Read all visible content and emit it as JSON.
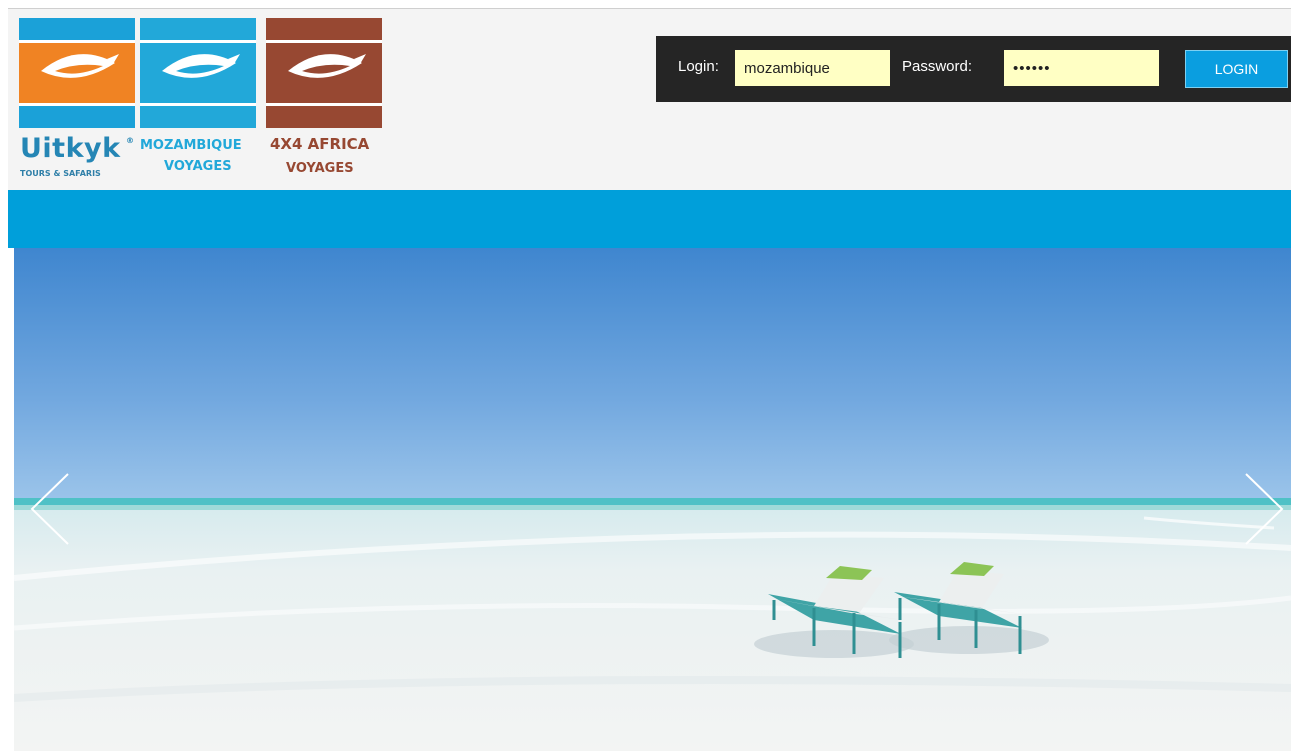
{
  "brands": {
    "uitkyk": {
      "name": "Uitkyk",
      "registered": "®",
      "subtitle": "TOURS & SAFARIS",
      "icon": "eye-logo-icon",
      "color": "#f08323"
    },
    "mozambique": {
      "line1": "MOZAMBIQUE",
      "line2": "VOYAGES",
      "icon": "eye-logo-icon",
      "color": "#22a8d9"
    },
    "africa": {
      "line1": "4X4 AFRICA",
      "line2": "VOYAGES",
      "icon": "eye-logo-icon",
      "color": "#974832"
    }
  },
  "login_form": {
    "login_label": "Login:",
    "login_value": "mozambique",
    "password_label": "Password:",
    "password_value": "••••••",
    "button_label": "LOGIN"
  },
  "carousel": {
    "prev_icon": "chevron-left-icon",
    "next_icon": "chevron-right-icon",
    "slide": "beach-loungers-slide"
  },
  "colors": {
    "nav_strip": "#009fda",
    "login_bar": "#252525",
    "login_field": "#ffffc4",
    "login_button": "#0a9ee0"
  }
}
